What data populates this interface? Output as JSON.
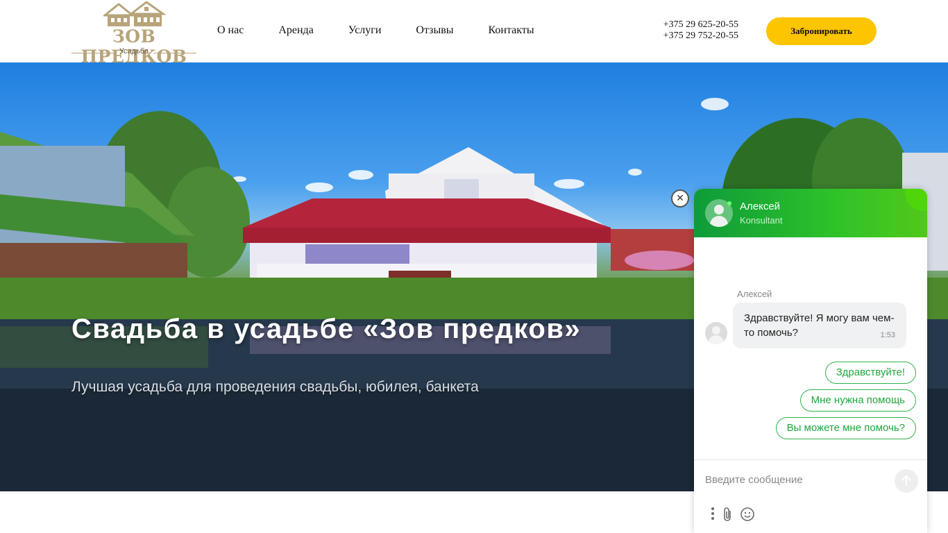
{
  "header": {
    "logo": {
      "title": "ЗОВ ПРЕДКОВ",
      "subtitle": "Усадьба",
      "icon": "house-logo-icon",
      "color": "#b8a47a"
    },
    "nav": [
      {
        "label": "О нас"
      },
      {
        "label": "Аренда"
      },
      {
        "label": "Услуги"
      },
      {
        "label": "Отзывы"
      },
      {
        "label": "Контакты"
      }
    ],
    "phones": [
      "+375 29 625-20-55",
      "+375 29 752-20-55"
    ],
    "book_label": "Забронировать",
    "book_color": "#fdc400"
  },
  "hero": {
    "title": "Свадьба в усадьбе «Зов предков»",
    "subtitle": "Лучшая усадьба для проведения свадьбы, юбилея, банкета"
  },
  "chat": {
    "close_icon": "close-icon",
    "agent": {
      "name": "Алексей",
      "role": "Konsultant"
    },
    "message": {
      "author": "Алексей",
      "text": "Здравствуйте! Я могу вам чем-то помочь?",
      "time": "1:53"
    },
    "quick_replies": [
      "Здравствуйте!",
      "Мне нужна помощь",
      "Вы можете мне помочь?"
    ],
    "input_placeholder": "Введите сообщение",
    "accent_color": "#1fa83c",
    "icons": [
      "more-vertical-icon",
      "paperclip-icon",
      "smile-icon",
      "send-arrow-icon"
    ]
  }
}
